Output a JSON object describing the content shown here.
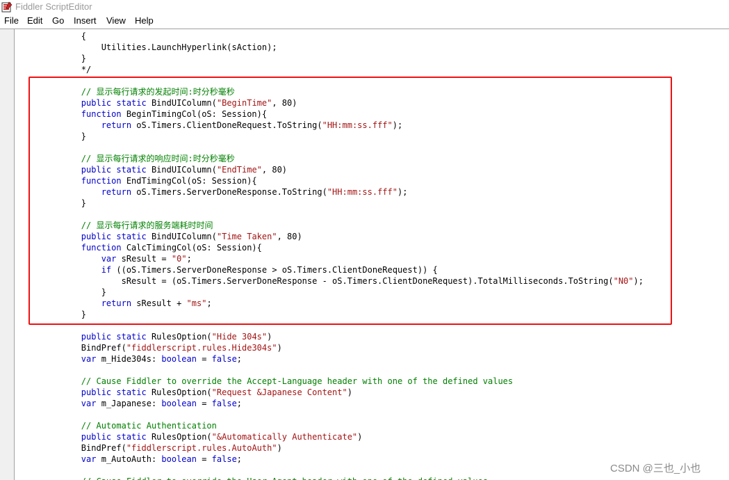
{
  "window": {
    "title": "Fiddler ScriptEditor",
    "icon": "fiddler-app-icon"
  },
  "menu": [
    {
      "id": "file",
      "label": "File"
    },
    {
      "id": "edit",
      "label": "Edit"
    },
    {
      "id": "go",
      "label": "Go"
    },
    {
      "id": "insert",
      "label": "Insert"
    },
    {
      "id": "view",
      "label": "View"
    },
    {
      "id": "help",
      "label": "Help"
    }
  ],
  "colors": {
    "keyword": "#0000cc",
    "string": "#a31515",
    "comment": "#008000",
    "highlight_border": "#ee1111"
  },
  "code": [
    [
      [
        "p",
        "        {"
      ]
    ],
    [
      [
        "p",
        "            Utilities.LaunchHyperlink(sAction);"
      ]
    ],
    [
      [
        "p",
        "        }"
      ]
    ],
    [
      [
        "p",
        "        */"
      ]
    ],
    [],
    [
      [
        "c",
        "        // 显示每行请求的发起时间:时分秒毫秒"
      ]
    ],
    [
      [
        "p",
        "        "
      ],
      [
        "k",
        "public static"
      ],
      [
        "p",
        " BindUIColumn("
      ],
      [
        "s",
        "\"BeginTime\""
      ],
      [
        "p",
        ", 80)"
      ]
    ],
    [
      [
        "p",
        "        "
      ],
      [
        "k",
        "function"
      ],
      [
        "p",
        " BeginTimingCol(oS: Session){"
      ]
    ],
    [
      [
        "p",
        "            "
      ],
      [
        "k",
        "return"
      ],
      [
        "p",
        " oS.Timers.ClientDoneRequest.ToString("
      ],
      [
        "s",
        "\"HH:mm:ss.fff\""
      ],
      [
        "p",
        ");"
      ]
    ],
    [
      [
        "p",
        "        }"
      ]
    ],
    [],
    [
      [
        "c",
        "        // 显示每行请求的响应时间:时分秒毫秒"
      ]
    ],
    [
      [
        "p",
        "        "
      ],
      [
        "k",
        "public static"
      ],
      [
        "p",
        " BindUIColumn("
      ],
      [
        "s",
        "\"EndTime\""
      ],
      [
        "p",
        ", 80)"
      ]
    ],
    [
      [
        "p",
        "        "
      ],
      [
        "k",
        "function"
      ],
      [
        "p",
        " EndTimingCol(oS: Session){"
      ]
    ],
    [
      [
        "p",
        "            "
      ],
      [
        "k",
        "return"
      ],
      [
        "p",
        " oS.Timers.ServerDoneResponse.ToString("
      ],
      [
        "s",
        "\"HH:mm:ss.fff\""
      ],
      [
        "p",
        ");"
      ]
    ],
    [
      [
        "p",
        "        }"
      ]
    ],
    [],
    [
      [
        "c",
        "        // 显示每行请求的服务端耗时时间"
      ]
    ],
    [
      [
        "p",
        "        "
      ],
      [
        "k",
        "public static"
      ],
      [
        "p",
        " BindUIColumn("
      ],
      [
        "s",
        "\"Time Taken\""
      ],
      [
        "p",
        ", 80)"
      ]
    ],
    [
      [
        "p",
        "        "
      ],
      [
        "k",
        "function"
      ],
      [
        "p",
        " CalcTimingCol(oS: Session){"
      ]
    ],
    [
      [
        "p",
        "            "
      ],
      [
        "k",
        "var"
      ],
      [
        "p",
        " sResult = "
      ],
      [
        "s",
        "\"0\""
      ],
      [
        "p",
        ";"
      ]
    ],
    [
      [
        "p",
        "            "
      ],
      [
        "k",
        "if"
      ],
      [
        "p",
        " ((oS.Timers.ServerDoneResponse > oS.Timers.ClientDoneRequest)) {"
      ]
    ],
    [
      [
        "p",
        "                sResult = (oS.Timers.ServerDoneResponse - oS.Timers.ClientDoneRequest).TotalMilliseconds.ToString("
      ],
      [
        "s",
        "\"N0\""
      ],
      [
        "p",
        ");"
      ]
    ],
    [
      [
        "p",
        "            }"
      ]
    ],
    [
      [
        "p",
        "            "
      ],
      [
        "k",
        "return"
      ],
      [
        "p",
        " sResult + "
      ],
      [
        "s",
        "\"ms\""
      ],
      [
        "p",
        ";"
      ]
    ],
    [
      [
        "p",
        "        }"
      ]
    ],
    [],
    [
      [
        "p",
        "        "
      ],
      [
        "k",
        "public static"
      ],
      [
        "p",
        " RulesOption("
      ],
      [
        "s",
        "\"Hide 304s\""
      ],
      [
        "p",
        ")"
      ]
    ],
    [
      [
        "p",
        "        BindPref("
      ],
      [
        "s",
        "\"fiddlerscript.rules.Hide304s\""
      ],
      [
        "p",
        ")"
      ]
    ],
    [
      [
        "p",
        "        "
      ],
      [
        "k",
        "var"
      ],
      [
        "p",
        " m_Hide304s: "
      ],
      [
        "k",
        "boolean"
      ],
      [
        "p",
        " = "
      ],
      [
        "k",
        "false"
      ],
      [
        "p",
        ";"
      ]
    ],
    [],
    [
      [
        "c",
        "        // Cause Fiddler to override the Accept-Language header with one of the defined values"
      ]
    ],
    [
      [
        "p",
        "        "
      ],
      [
        "k",
        "public static"
      ],
      [
        "p",
        " RulesOption("
      ],
      [
        "s",
        "\"Request &Japanese Content\""
      ],
      [
        "p",
        ")"
      ]
    ],
    [
      [
        "p",
        "        "
      ],
      [
        "k",
        "var"
      ],
      [
        "p",
        " m_Japanese: "
      ],
      [
        "k",
        "boolean"
      ],
      [
        "p",
        " = "
      ],
      [
        "k",
        "false"
      ],
      [
        "p",
        ";"
      ]
    ],
    [],
    [
      [
        "c",
        "        // Automatic Authentication"
      ]
    ],
    [
      [
        "p",
        "        "
      ],
      [
        "k",
        "public static"
      ],
      [
        "p",
        " RulesOption("
      ],
      [
        "s",
        "\"&Automatically Authenticate\""
      ],
      [
        "p",
        ")"
      ]
    ],
    [
      [
        "p",
        "        BindPref("
      ],
      [
        "s",
        "\"fiddlerscript.rules.AutoAuth\""
      ],
      [
        "p",
        ")"
      ]
    ],
    [
      [
        "p",
        "        "
      ],
      [
        "k",
        "var"
      ],
      [
        "p",
        " m_AutoAuth: "
      ],
      [
        "k",
        "boolean"
      ],
      [
        "p",
        " = "
      ],
      [
        "k",
        "false"
      ],
      [
        "p",
        ";"
      ]
    ],
    [],
    [
      [
        "c",
        "        // Cause Fiddler to override the User-Agent header with one of the defined values"
      ]
    ]
  ],
  "watermark": "CSDN @三也_小也"
}
